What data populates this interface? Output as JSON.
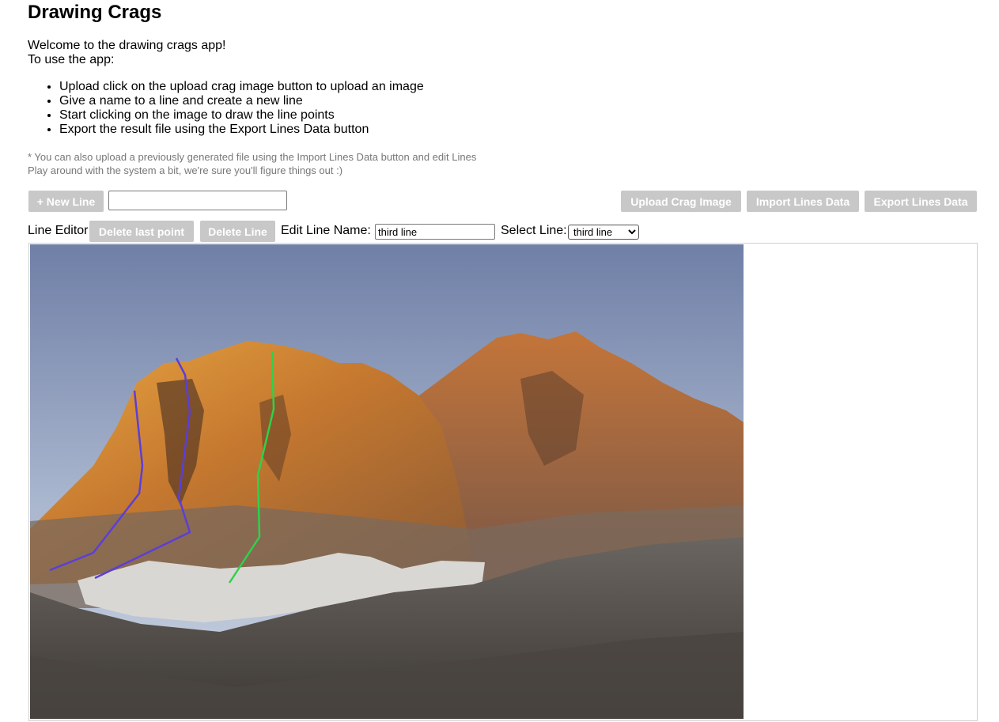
{
  "app": {
    "title": "Drawing Crags"
  },
  "intro": {
    "welcome": "Welcome to the drawing crags app!",
    "howto": "To use the app:"
  },
  "steps": [
    "Upload click on the upload crag image button to upload an image",
    "Give a name to a line and create a new line",
    "Start clicking on the image to draw the line points",
    "Export the result file using the Export Lines Data button"
  ],
  "notes": {
    "import_note": "* You can also upload a previously generated file using the Import Lines Data button and edit Lines",
    "play_note": "Play around with the system a bit, we're sure you'll figure things out :)"
  },
  "toolbar": {
    "new_line_label": "+ New Line",
    "new_line_name_value": "",
    "upload_label": "Upload Crag Image",
    "import_label": "Import Lines Data",
    "export_label": "Export Lines Data"
  },
  "editor": {
    "label": "Line Editor",
    "delete_point_label": "Delete last point",
    "delete_line_label": "Delete Line",
    "edit_name_label": "Edit Line Name:",
    "edit_name_value": "third line",
    "select_label": "Select Line:",
    "select_value": "third line"
  },
  "colors": {
    "button_bg": "#c8c8c8",
    "line_purple": "#5b3fd6",
    "line_green": "#2fd14a"
  }
}
